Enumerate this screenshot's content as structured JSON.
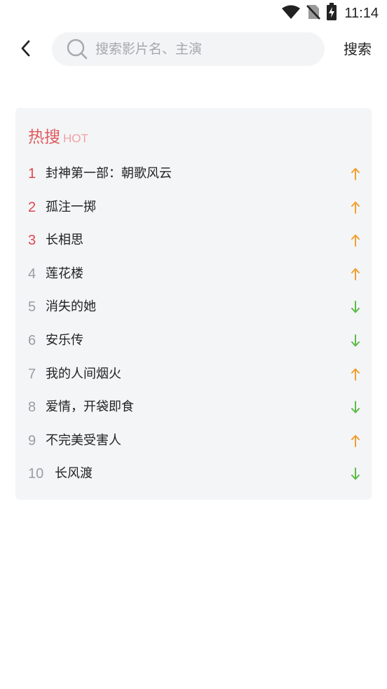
{
  "status_bar": {
    "time": "11:14",
    "icons": [
      "wifi-icon",
      "no-sim-icon",
      "battery-charging-icon"
    ]
  },
  "header": {
    "back_icon": "chevron-left-icon",
    "search": {
      "placeholder": "搜索影片名、主演",
      "value": ""
    },
    "search_button": "搜索"
  },
  "hot_search": {
    "title": "热搜",
    "subtitle": "HOT",
    "colors": {
      "title": "#e05a5e",
      "subtitle": "#f1a2a5",
      "top_rank": "#e0474f",
      "up": "#f0a030",
      "down": "#5dbb48"
    },
    "items": [
      {
        "rank": "1",
        "title": "封神第一部：朝歌风云",
        "trend": "up"
      },
      {
        "rank": "2",
        "title": "孤注一掷",
        "trend": "up"
      },
      {
        "rank": "3",
        "title": "长相思",
        "trend": "up"
      },
      {
        "rank": "4",
        "title": "莲花楼",
        "trend": "up"
      },
      {
        "rank": "5",
        "title": "消失的她",
        "trend": "down"
      },
      {
        "rank": "6",
        "title": "安乐传",
        "trend": "down"
      },
      {
        "rank": "7",
        "title": "我的人间烟火",
        "trend": "up"
      },
      {
        "rank": "8",
        "title": "爱情，开袋即食",
        "trend": "down"
      },
      {
        "rank": "9",
        "title": "不完美受害人",
        "trend": "up"
      },
      {
        "rank": "10",
        "title": "长风渡",
        "trend": "down"
      }
    ]
  }
}
